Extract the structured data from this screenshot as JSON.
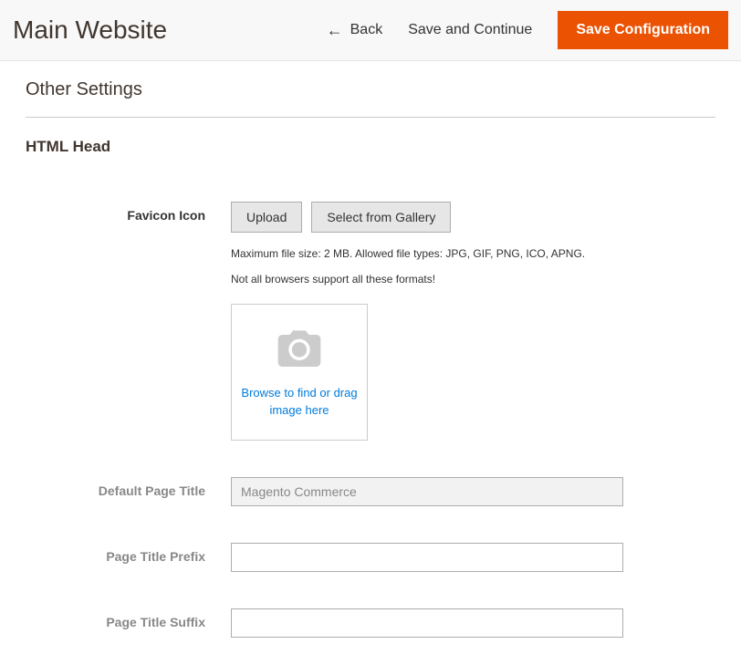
{
  "header": {
    "title": "Main Website",
    "back_label": "Back",
    "save_continue_label": "Save and Continue",
    "save_config_label": "Save Configuration"
  },
  "section": {
    "title": "Other Settings",
    "subsection": "HTML Head"
  },
  "favicon": {
    "label": "Favicon Icon",
    "upload_label": "Upload",
    "gallery_label": "Select from Gallery",
    "note1": "Maximum file size: 2 MB. Allowed file types: JPG, GIF, PNG, ICO, APNG.",
    "note2": "Not all browsers support all these formats!",
    "dropzone_text": "Browse to find or drag image here"
  },
  "fields": {
    "default_title": {
      "label": "Default Page Title",
      "value": "Magento Commerce"
    },
    "title_prefix": {
      "label": "Page Title Prefix",
      "value": ""
    },
    "title_suffix": {
      "label": "Page Title Suffix",
      "value": ""
    }
  }
}
